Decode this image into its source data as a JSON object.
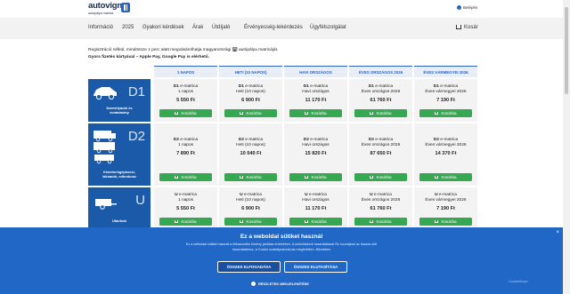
{
  "header": {
    "logo_text": "autovignet",
    "logo_sub": "autópálya matrica",
    "login_label": "Belépés"
  },
  "nav": {
    "items": [
      "Információ",
      "2025",
      "Gyakori kérdések",
      "Árak",
      "Útdíjaló",
      "Érvényesség-lekérdezés",
      "Ügyfélszolgálat"
    ],
    "cart_label": "Kosár"
  },
  "intro": {
    "line1": "Regisztráció nélkül, mindössze 1 perc alatt megvásárolhatja magyarországi 🛣 autópálya matricáját.",
    "line2": "Gyors fizetés kártyával – Apple Pay, Google Pay is elérhető."
  },
  "columns": [
    "1 NAPOS",
    "HETI (10 NAPOS)",
    "HAVI ORSZÁGOS",
    "ÉVES ORSZÁGOS 2026",
    "ÉVES VÁRMEGYEI 2026"
  ],
  "rows": [
    {
      "code": "D1",
      "label": "Személyautó és\nvontatmány",
      "cells": [
        {
          "cat": "D1",
          "desc": "e-matrica",
          "period": "1 napos",
          "price": "5 550 Ft"
        },
        {
          "cat": "D1",
          "desc": "e-matrica",
          "period": "Heti (10 napos)",
          "price": "6 900 Ft"
        },
        {
          "cat": "D1",
          "desc": "e-matrica",
          "period": "Havi országos",
          "price": "11 170 Ft"
        },
        {
          "cat": "D1",
          "desc": "e-matrica",
          "period": "Éves országos 2026",
          "price": "61 760 Ft"
        },
        {
          "cat": "D1",
          "desc": "e-matrica",
          "period": "Éves vármegyei 2026",
          "price": "7 190 Ft"
        }
      ]
    },
    {
      "code": "D2",
      "label": "Kisteherkgépkocsi,\nlakóautó, mikrobusz",
      "cells": [
        {
          "cat": "D2",
          "desc": "e-matrica",
          "period": "1 napos",
          "price": "7 890 Ft"
        },
        {
          "cat": "D2",
          "desc": "e-matrica",
          "period": "Heti (10 napos)",
          "price": "10 040 Ft"
        },
        {
          "cat": "D2",
          "desc": "e-matrica",
          "period": "Havi országos",
          "price": "15 820 Ft"
        },
        {
          "cat": "D2",
          "desc": "e-matrica",
          "period": "Éves országos 2026",
          "price": "87 650 Ft"
        },
        {
          "cat": "D2",
          "desc": "e-matrica",
          "period": "Éves vármegyei 2026",
          "price": "14 370 Ft"
        }
      ]
    },
    {
      "code": "U",
      "label": "Utánfutó",
      "cells": [
        {
          "cat": "U",
          "desc": "e-matrica",
          "period": "1 napos",
          "price": "5 550 Ft"
        },
        {
          "cat": "U",
          "desc": "e-matrica",
          "period": "Heti (10 napos)",
          "price": "6 900 Ft"
        },
        {
          "cat": "U",
          "desc": "e-matrica",
          "period": "Havi országos",
          "price": "11 170 Ft"
        },
        {
          "cat": "U",
          "desc": "e-matrica",
          "period": "Éves országos 2026",
          "price": "61 760 Ft"
        },
        {
          "cat": "U",
          "desc": "e-matrica",
          "period": "Éves vármegyei 2026",
          "price": "7 190 Ft"
        }
      ]
    }
  ],
  "buy_label": "Kosárba",
  "cookie": {
    "title": "Ez a weboldal sütiket használ",
    "text": "Ez a weboldal sütiket használ a felhasználói élmény javítása érdekében. A weboldalunk használatával Ön hozzájárul az összes süti használatához, a Cookie szabályzatunknak megfelelően. Bővebben",
    "accept_label": "ÖSSZES ELFOGADÁSA",
    "reject_label": "ÖSSZES ELUTASÍTÁSA",
    "details_label": "RÉSZLETEK MEGJELENÍTÉSE",
    "close_label": "×",
    "brand_corner": "CookieScript"
  },
  "colors": {
    "primary_blue": "#2167c6",
    "row_blue": "#1a5aa8",
    "buy_green": "#36a852"
  }
}
